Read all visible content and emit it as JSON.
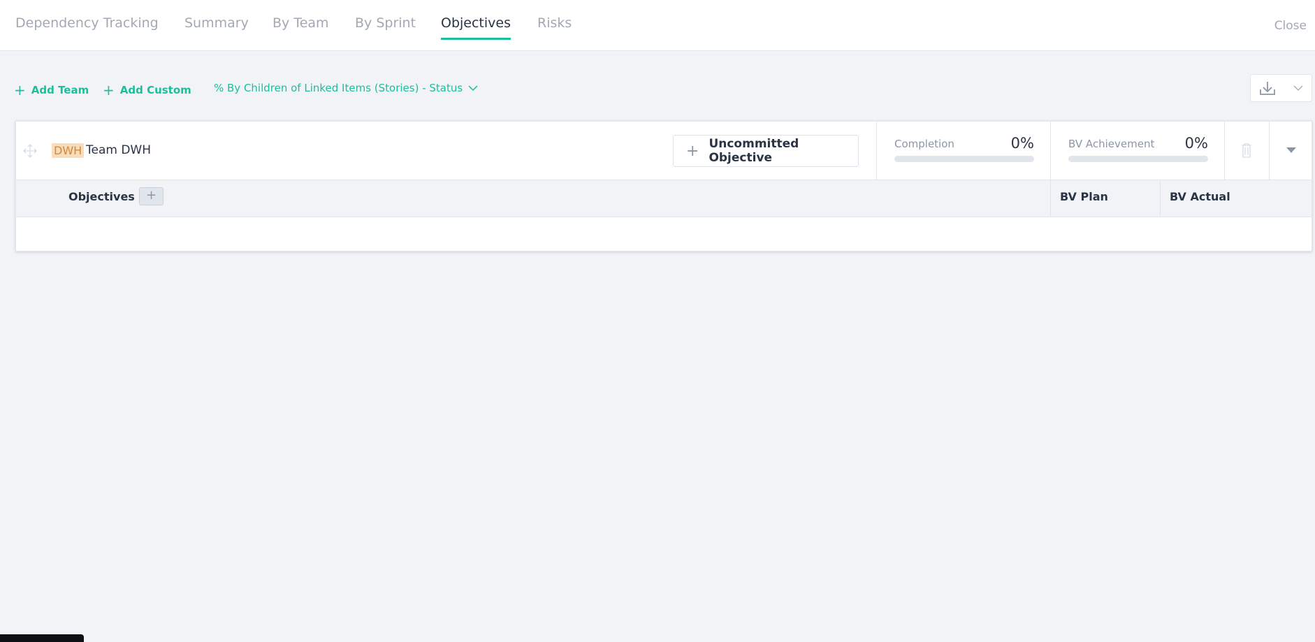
{
  "tabs": [
    {
      "label": "Dependency Tracking"
    },
    {
      "label": "Summary"
    },
    {
      "label": "By Team"
    },
    {
      "label": "By Sprint"
    },
    {
      "label": "Objectives",
      "active": true
    },
    {
      "label": "Risks"
    }
  ],
  "close_label": "Close",
  "toolbar": {
    "add_team": "Add Team",
    "add_custom": "Add Custom",
    "progress_mode": "% By Children of Linked Items (Stories) - Status"
  },
  "team": {
    "badge": "DWH",
    "name": "Team DWH",
    "uncommitted_label": "Uncommitted Objective",
    "completion": {
      "label": "Completion",
      "value": "0%",
      "percent": 0
    },
    "bv_achievement": {
      "label": "BV Achievement",
      "value": "0%",
      "percent": 0
    }
  },
  "columns": {
    "objectives": "Objectives",
    "bv_plan": "BV Plan",
    "bv_actual": "BV Actual"
  },
  "colors": {
    "accent": "#1bbf9c",
    "badge_bg": "#f8dcbc"
  }
}
